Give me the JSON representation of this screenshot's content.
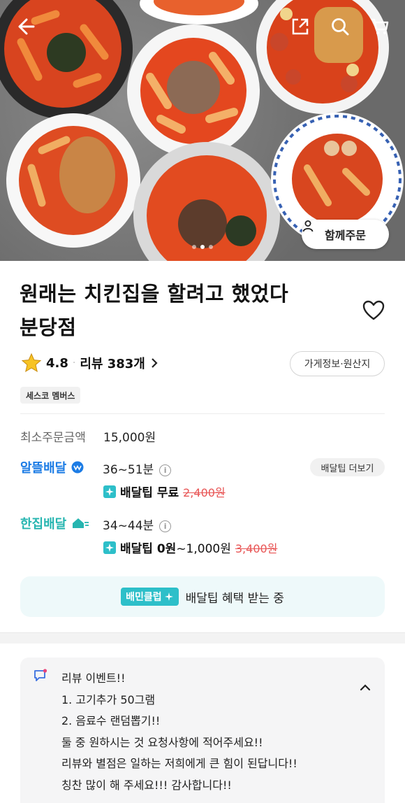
{
  "hero": {
    "group_order_label": "함께주문",
    "slide_count": 3,
    "active_slide": 1,
    "icons": [
      "back-arrow-icon",
      "share-icon",
      "search-icon",
      "cart-icon"
    ]
  },
  "store": {
    "name_line1": "원래는 치킨집을 할려고 했었다",
    "name_line2": "분당점",
    "rating": "4.8",
    "review_label": "리뷰 383개",
    "info_button": "가게정보·원산지",
    "badge": "세스코 멤버스"
  },
  "order": {
    "min_label": "최소주문금액",
    "min_value": "15,000원"
  },
  "delivery": {
    "alddeul": {
      "name": "알뜰배달",
      "time": "36~51분",
      "tip_label": "배달팁 무료",
      "tip_original": "2,400원",
      "more_button": "배달팁 더보기"
    },
    "hanjip": {
      "name": "한집배달",
      "time": "34~44분",
      "tip_label": "배달팁 0원",
      "tip_range": "~1,000원",
      "tip_original": "3,400원"
    }
  },
  "club": {
    "badge": "배민클럽",
    "text": "배달팁 혜택 받는 중"
  },
  "notice": {
    "lines": [
      "리뷰 이벤트!!",
      "1. 고기추가 50그램",
      "2. 음료수 랜덤뽑기!!",
      "둘 중 원하시는 것 요청사항에 적어주세요!!",
      "리뷰와 별점은 일하는 저희에게 큰 힘이 된답니다!!",
      "칭찬 많이 해 주세요!!! 감사합니다!!"
    ]
  },
  "colors": {
    "accent_blue": "#1c7ce5",
    "accent_teal": "#2dbfc9",
    "strike_red": "#e85555",
    "star": "#f7c324"
  }
}
